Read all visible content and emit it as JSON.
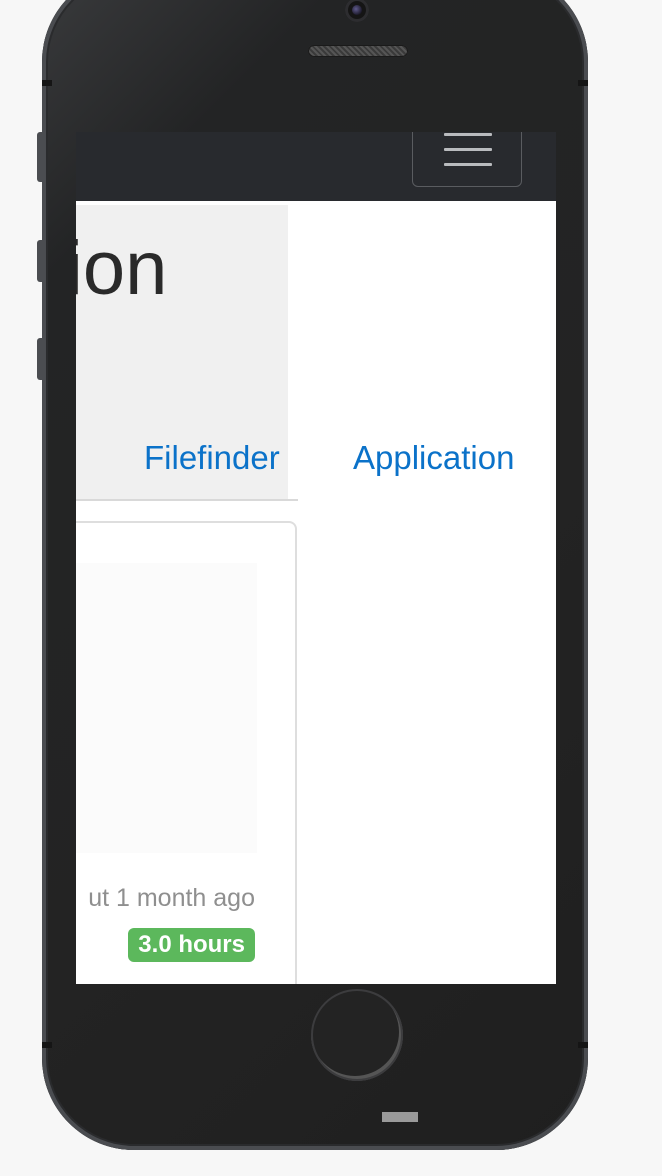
{
  "hero": {
    "title_partial": "ion"
  },
  "nav_links": {
    "filefinder": "Filefinder",
    "application": "Application"
  },
  "card": {
    "meta": "ut 1 month ago",
    "badge": "3.0 hours",
    "badge_color": "#5cb85c"
  },
  "navbar": {
    "toggler_icon": "hamburger-icon"
  },
  "colors": {
    "link": "#0b72c9",
    "navbar": "#282a2e"
  }
}
